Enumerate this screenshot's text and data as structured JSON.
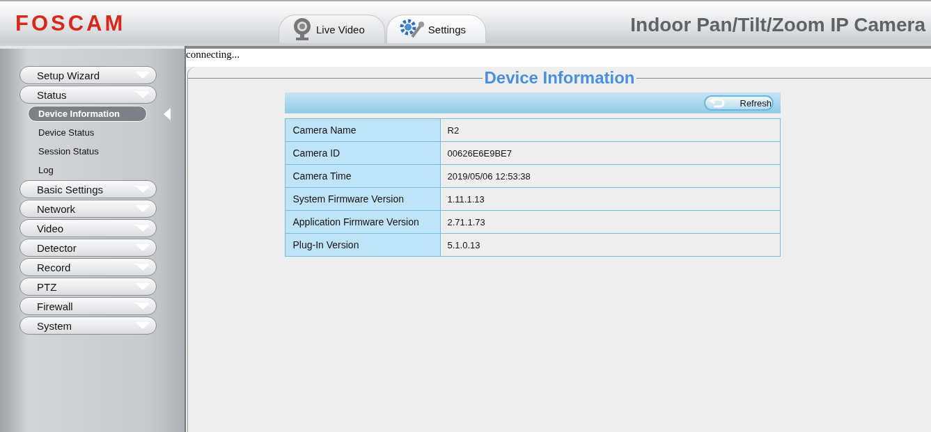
{
  "header": {
    "logo": "FOSCAM",
    "tabs": [
      {
        "label": "Live Video",
        "kind": "camera",
        "selected": false
      },
      {
        "label": "Settings",
        "kind": "tools",
        "selected": true
      }
    ],
    "title": "Indoor Pan/Tilt/Zoom IP Camera"
  },
  "status_text": "connecting...",
  "sidebar": {
    "items": [
      {
        "label": "Setup Wizard"
      },
      {
        "label": "Status",
        "children": [
          {
            "label": "Device Information",
            "selected": true
          },
          {
            "label": "Device Status",
            "selected": false
          },
          {
            "label": "Session Status",
            "selected": false
          },
          {
            "label": "Log",
            "selected": false
          }
        ]
      },
      {
        "label": "Basic Settings"
      },
      {
        "label": "Network"
      },
      {
        "label": "Video"
      },
      {
        "label": "Detector"
      },
      {
        "label": "Record"
      },
      {
        "label": "PTZ"
      },
      {
        "label": "Firewall"
      },
      {
        "label": "System"
      }
    ]
  },
  "panel": {
    "title": "Device Information",
    "refresh_button": "Refresh",
    "rows": [
      {
        "label": "Camera Name",
        "value": "R2"
      },
      {
        "label": "Camera ID",
        "value": "00626E6E9BE7"
      },
      {
        "label": "Camera Time",
        "value": "2019/05/06 12:53:38"
      },
      {
        "label": "System Firmware Version",
        "value": "1.11.1.13"
      },
      {
        "label": "Application Firmware Version",
        "value": "2.71.1.73"
      },
      {
        "label": "Plug-In Version",
        "value": "5.1.0.13"
      }
    ]
  }
}
